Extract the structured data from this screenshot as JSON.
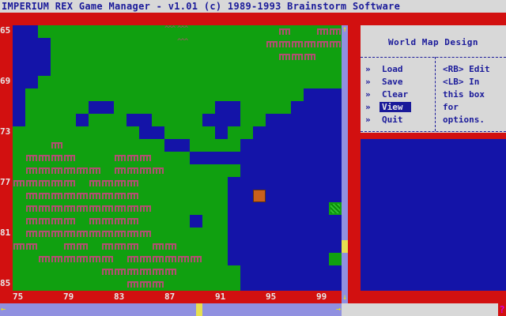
{
  "window": {
    "title": "IMPERIUM REX Game Manager - v1.01 (c) 1989-1993 Brainstorm Software"
  },
  "map": {
    "legend": {
      "G": "grass",
      "W": "water",
      "F": "forest",
      "M": "mountains",
      "U": "unit",
      "S": "swamp",
      "Y": "scroll-marker"
    },
    "rows": [
      "WWGGGGGGGGGGMMGGGGGGGFGGFF",
      "WWWGGGGGGGGGGMGGGGGGFFFFFF",
      "WWWGGGGGGGGGGGGGGGGGGFFFGG",
      "WWWGGGGGGGGGGGGGGGGGGGGGGG",
      "WWGGGGGGGGGGGGGGGGGGGGGGGG",
      "WGGGGGGGGGGGGGGGGGGGGGGWWW",
      "WGGGGGWWGGGGGGGGWWGGGGWWWW",
      "WGGGGWGGGWWGGGGWWWGGWWWWWW",
      "GGGGGGGGGGWWGGGGWGGWWWWWWW",
      "GGGFGGGGGGGGWWGGGGWWWWWWWW",
      "GFFFFGGGFFFGGGWWWWWWWWWWWW",
      "GFFFFFFGFFFFGGGGGGWWWWWWWW",
      "FFFFFGFFFFGGGGGGGWWWWWWWWW",
      "GFFFFFFFFFGGGGGGGWWUWWWWWW",
      "GFFFFFFFFFFGGGGGGWWWWWWWWS",
      "GFFFFGFFFFGGGGWGGWWWWWWWWW",
      "GFFFFFFFFFFGGGGGGWWWWWWWWW",
      "FFGGFFGFFFGFFGGGGWWWWWWWWW",
      "GGFFFFFFGFFFFFFGGWWWWWWWWG",
      "GGGGGGGFFFFFFGGGGGWWWWWWWW",
      "GGGGGGGGGFFFGGGGGGWWWWWWWW"
    ]
  },
  "axes": {
    "y_labels": [
      "65",
      "69",
      "73",
      "77",
      "81",
      "85"
    ],
    "x_labels": [
      "75",
      "79",
      "83",
      "87",
      "91",
      "95",
      "99"
    ]
  },
  "panel": {
    "title": "World Map Design",
    "bullet": "»",
    "menu": [
      {
        "label": "Load",
        "selected": false
      },
      {
        "label": "Save",
        "selected": false
      },
      {
        "label": "Clear",
        "selected": false
      },
      {
        "label": "View",
        "selected": true
      },
      {
        "label": "Quit",
        "selected": false
      }
    ],
    "help_lines": [
      "<RB> Edit",
      "<LB> In",
      "this box",
      "for",
      "options."
    ]
  },
  "scrollbar": {
    "up_arrow": "↑",
    "down_arrow": "↓",
    "left_arrow": "←",
    "right_arrow": "→"
  },
  "help_char": "?",
  "colors": {
    "background": "#d21010",
    "grass": "#10a010",
    "water": "#1414a8",
    "panel": "#d8d8d8",
    "text": "#1a1a9a"
  }
}
